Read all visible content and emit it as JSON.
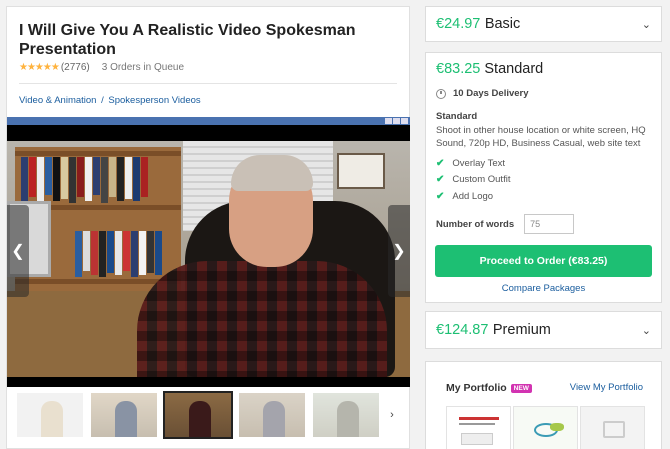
{
  "gig": {
    "title": "I Will Give You A Realistic Video Spokesman Presentation",
    "stars": "★★★★★",
    "rating_count": "(2776)",
    "orders_in_queue": "3 Orders in Queue",
    "breadcrumb": [
      "Video & Animation",
      "/",
      "Spokesperson Videos"
    ]
  },
  "gallery": {
    "prev_icon": "chevron-left-icon",
    "next_icon": "chevron-right-icon",
    "thumb_next": "›",
    "thumb_count": 5,
    "active_thumb": 3
  },
  "packages": {
    "basic": {
      "price": "€24.97",
      "name": "Basic"
    },
    "standard": {
      "price": "€83.25",
      "name": "Standard",
      "delivery": "10 Days Delivery",
      "label": "Standard",
      "description": "Shoot in other house location or white screen, HQ Sound, 720p HD, Business Casual, web site text",
      "features": [
        "Overlay Text",
        "Custom Outfit",
        "Add Logo"
      ],
      "words_label": "Number of words",
      "words_value": "75",
      "order_button": "Proceed to Order (€83.25)",
      "compare_link": "Compare Packages"
    },
    "premium": {
      "price": "€124.87",
      "name": "Premium"
    }
  },
  "portfolio": {
    "title": "My Portfolio",
    "badge": "NEW",
    "view_link": "View My Portfolio"
  },
  "colors": {
    "accent_green": "#1dbf73",
    "link_blue": "#1a5d9e",
    "star_yellow": "#ffb33e",
    "new_badge": "#d233b1"
  }
}
